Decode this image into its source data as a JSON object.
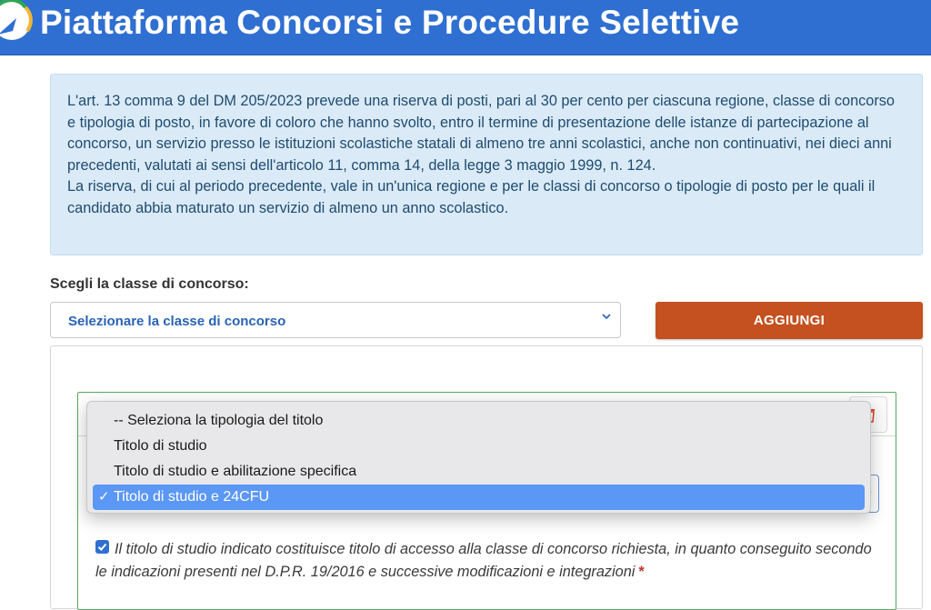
{
  "header": {
    "title": "Piattaforma Concorsi e Procedure Selettive"
  },
  "info": {
    "paragraph1": "L'art. 13 comma 9 del DM 205/2023 prevede una riserva di posti, pari al 30 per cento per ciascuna regione, classe di concorso e tipologia di posto, in favore di coloro che hanno svolto, entro il termine di presentazione delle istanze di partecipazione al concorso, un servizio presso le istituzioni scolastiche statali di almeno tre anni scolastici, anche non continuativi, nei dieci anni precedenti, valutati ai sensi dell'articolo 11, comma 14, della legge 3 maggio 1999, n. 124.",
    "paragraph2": "La riserva, di cui al periodo precedente, vale in un'unica regione e per le classi di concorso o tipologie di posto per le quali il candidato abbia maturato un servizio di almeno un anno scolastico."
  },
  "form": {
    "classe_label": "Scegli la classe di concorso:",
    "classe_selected": "Selezionare la classe di concorso",
    "add_button": "AGGIUNGI"
  },
  "tipologia_dropdown": {
    "options": [
      "-- Seleziona la tipologia del titolo",
      "Titolo di studio",
      "Titolo di studio e abilitazione specifica",
      "Titolo di studio e 24CFU"
    ],
    "selected_index": 3,
    "check_glyph": "✓"
  },
  "declaration": {
    "checked": true,
    "text": "Il titolo di studio indicato costituisce titolo di accesso alla classe di concorso richiesta, in quanto conseguito secondo le indicazioni presenti nel D.P.R. 19/2016 e successive modificazioni e integrazioni",
    "required_mark": "*"
  },
  "colors": {
    "header_bg": "#2f6fd1",
    "info_bg": "#dbeaf7",
    "info_text": "#1e4c70",
    "accent_orange": "#c4511f",
    "selected_option": "#5b97f5",
    "green_border": "#5aa85e",
    "required_red": "#c0392b"
  },
  "icons": {
    "logo": "platform-logo-icon",
    "select_chevron": "chevron-down-icon",
    "delete": "trash-icon",
    "checkbox": "checkmark-icon"
  }
}
